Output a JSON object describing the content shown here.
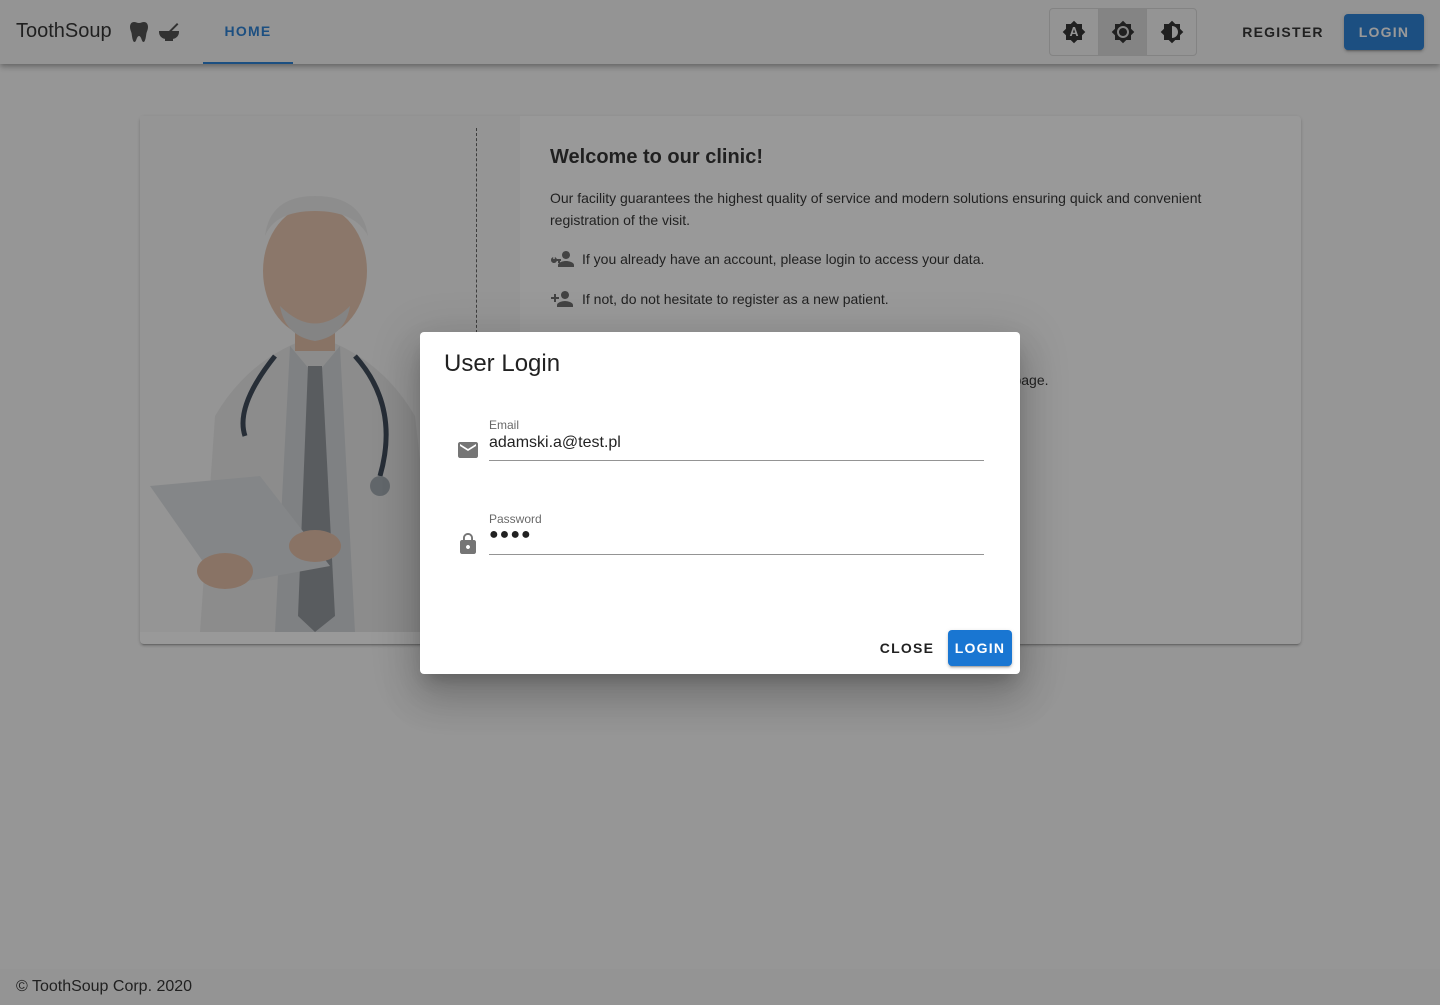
{
  "app": {
    "brand": "ToothSoup",
    "brand_icons": [
      "tooth-icon",
      "mortar-pestle-icon"
    ],
    "tabs": [
      {
        "label": "HOME",
        "active": true
      }
    ],
    "theme_buttons": [
      {
        "icon": "brightness-auto-icon",
        "active": false
      },
      {
        "icon": "brightness-light-icon",
        "active": true
      },
      {
        "icon": "brightness-dark-icon",
        "active": false
      }
    ],
    "register_label": "REGISTER",
    "login_label": "LOGIN",
    "accent": "#1976d2"
  },
  "card": {
    "heading": "Welcome to our clinic!",
    "intro": "Our facility guarantees the highest quality of service and modern solutions ensuring quick and convenient registration of the visit.",
    "lines": [
      {
        "icon": "account-key-icon",
        "text": "If you already have an account, please login to access your data."
      },
      {
        "icon": "account-plus-icon",
        "text": "If not, do not hesitate to register as a new patient."
      }
    ],
    "settings_fragment": "tings page."
  },
  "dialog": {
    "title": "User Login",
    "email": {
      "label": "Email",
      "value": "adamski.a@test.pl",
      "icon": "email-icon"
    },
    "password": {
      "label": "Password",
      "value": "●●●●",
      "icon": "lock-icon"
    },
    "close_label": "CLOSE",
    "login_label": "LOGIN"
  },
  "footer": {
    "text": "© ToothSoup Corp. 2020"
  }
}
